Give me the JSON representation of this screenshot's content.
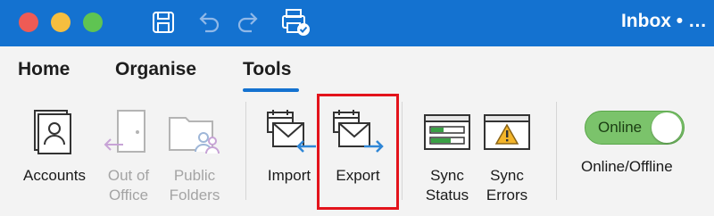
{
  "window": {
    "title": "Inbox • …",
    "controls": [
      "close",
      "minimize",
      "maximize"
    ],
    "toolbar_icons": [
      "save-icon",
      "undo-icon",
      "redo-icon",
      "print-icon"
    ]
  },
  "tabs": [
    {
      "label": "Home",
      "active": false
    },
    {
      "label": "Organise",
      "active": false
    },
    {
      "label": "Tools",
      "active": true
    }
  ],
  "ribbon": {
    "accounts": {
      "line1": "Accounts",
      "icon": "accounts-icon"
    },
    "out_of_office": {
      "line1": "Out of",
      "line2": "Office",
      "icon": "out-of-office-icon",
      "disabled": true
    },
    "public_folders": {
      "line1": "Public",
      "line2": "Folders",
      "icon": "public-folders-icon",
      "disabled": true
    },
    "import": {
      "line1": "Import",
      "icon": "import-icon"
    },
    "export": {
      "line1": "Export",
      "icon": "export-icon",
      "highlighted": true
    },
    "sync_status": {
      "line1": "Sync",
      "line2": "Status",
      "icon": "sync-status-icon"
    },
    "sync_errors": {
      "line1": "Sync",
      "line2": "Errors",
      "icon": "sync-errors-icon"
    },
    "online_toggle": {
      "state_label": "Online",
      "caption": "Online/Offline",
      "on": true
    }
  },
  "colors": {
    "title_bar": "#1472d0",
    "accent": "#1472d0",
    "highlight_box": "#e3131b",
    "toggle_on": "#7bc36b"
  }
}
